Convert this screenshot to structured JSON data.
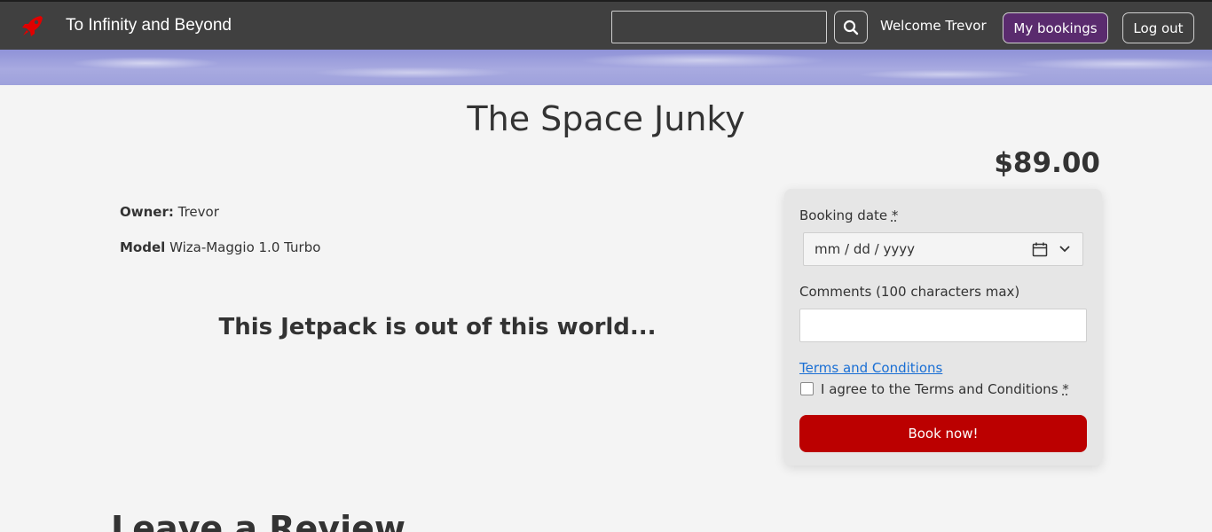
{
  "navbar": {
    "brand_title": "To Infinity and Beyond",
    "brand_icon": "rocket-icon",
    "search": {
      "value": "",
      "icon": "search-icon"
    },
    "welcome_text": "Welcome Trevor",
    "bookings_label": "My bookings",
    "logout_label": "Log out",
    "colors": {
      "background": "#404040",
      "bookings_button": "#5a2b6e"
    }
  },
  "listing": {
    "title": "The Space Junky",
    "price": "$89.00",
    "owner_label": "Owner:",
    "owner_value": "Trevor",
    "model_label": "Model",
    "model_value": "Wiza-Maggio 1.0 Turbo",
    "tagline": "This Jetpack is out of this world..."
  },
  "booking_form": {
    "date_label": "Booking date",
    "required_mark": "*",
    "date_placeholder": "mm / dd / yyyy",
    "date_icons": [
      "calendar-icon",
      "chevron-down-icon"
    ],
    "comments_label": "Comments (100 characters max)",
    "comments_value": "",
    "terms_link": "Terms and Conditions",
    "agree_label": "I agree to the Terms and Conditions",
    "agree_checked": false,
    "submit_label": "Book now!",
    "colors": {
      "submit_button": "#bb0000",
      "link": "#1a6fd4"
    }
  },
  "reviews": {
    "heading": "Leave a Review"
  }
}
